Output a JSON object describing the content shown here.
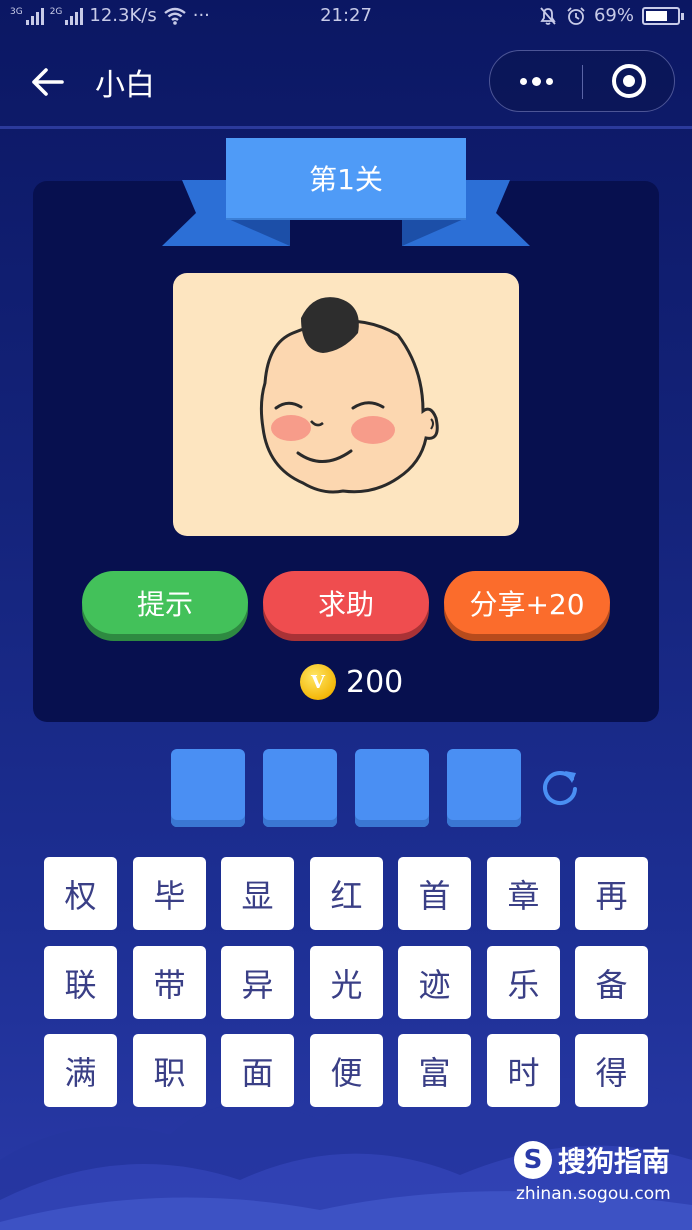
{
  "status_bar": {
    "net_3g": "3G",
    "net_2g": "2G",
    "speed": "12.3K/s",
    "more": "···",
    "time": "21:27",
    "battery": "69%",
    "battery_level": 0.69
  },
  "nav": {
    "title": "小白"
  },
  "level": {
    "label": "第1关"
  },
  "actions": {
    "hint": "提示",
    "help": "求助",
    "share": "分享+20"
  },
  "coins": {
    "icon_letter": "V",
    "count": "200"
  },
  "answer_slots": [
    "",
    "",
    "",
    ""
  ],
  "keyboard": [
    [
      "权",
      "毕",
      "显",
      "红",
      "首",
      "章",
      "再"
    ],
    [
      "联",
      "带",
      "异",
      "光",
      "迹",
      "乐",
      "备"
    ],
    [
      "满",
      "职",
      "面",
      "便",
      "富",
      "时",
      "得"
    ]
  ],
  "watermark": {
    "logo": "S",
    "name": "搜狗指南",
    "url": "zhinan.sogou.com"
  },
  "colors": {
    "background": "#14237a",
    "card": "#07104f",
    "ribbon": "#4f9bf7",
    "hint": "#43c15a",
    "help": "#ef4d4f",
    "share": "#fb6c2c",
    "slot": "#4a8ff3"
  }
}
